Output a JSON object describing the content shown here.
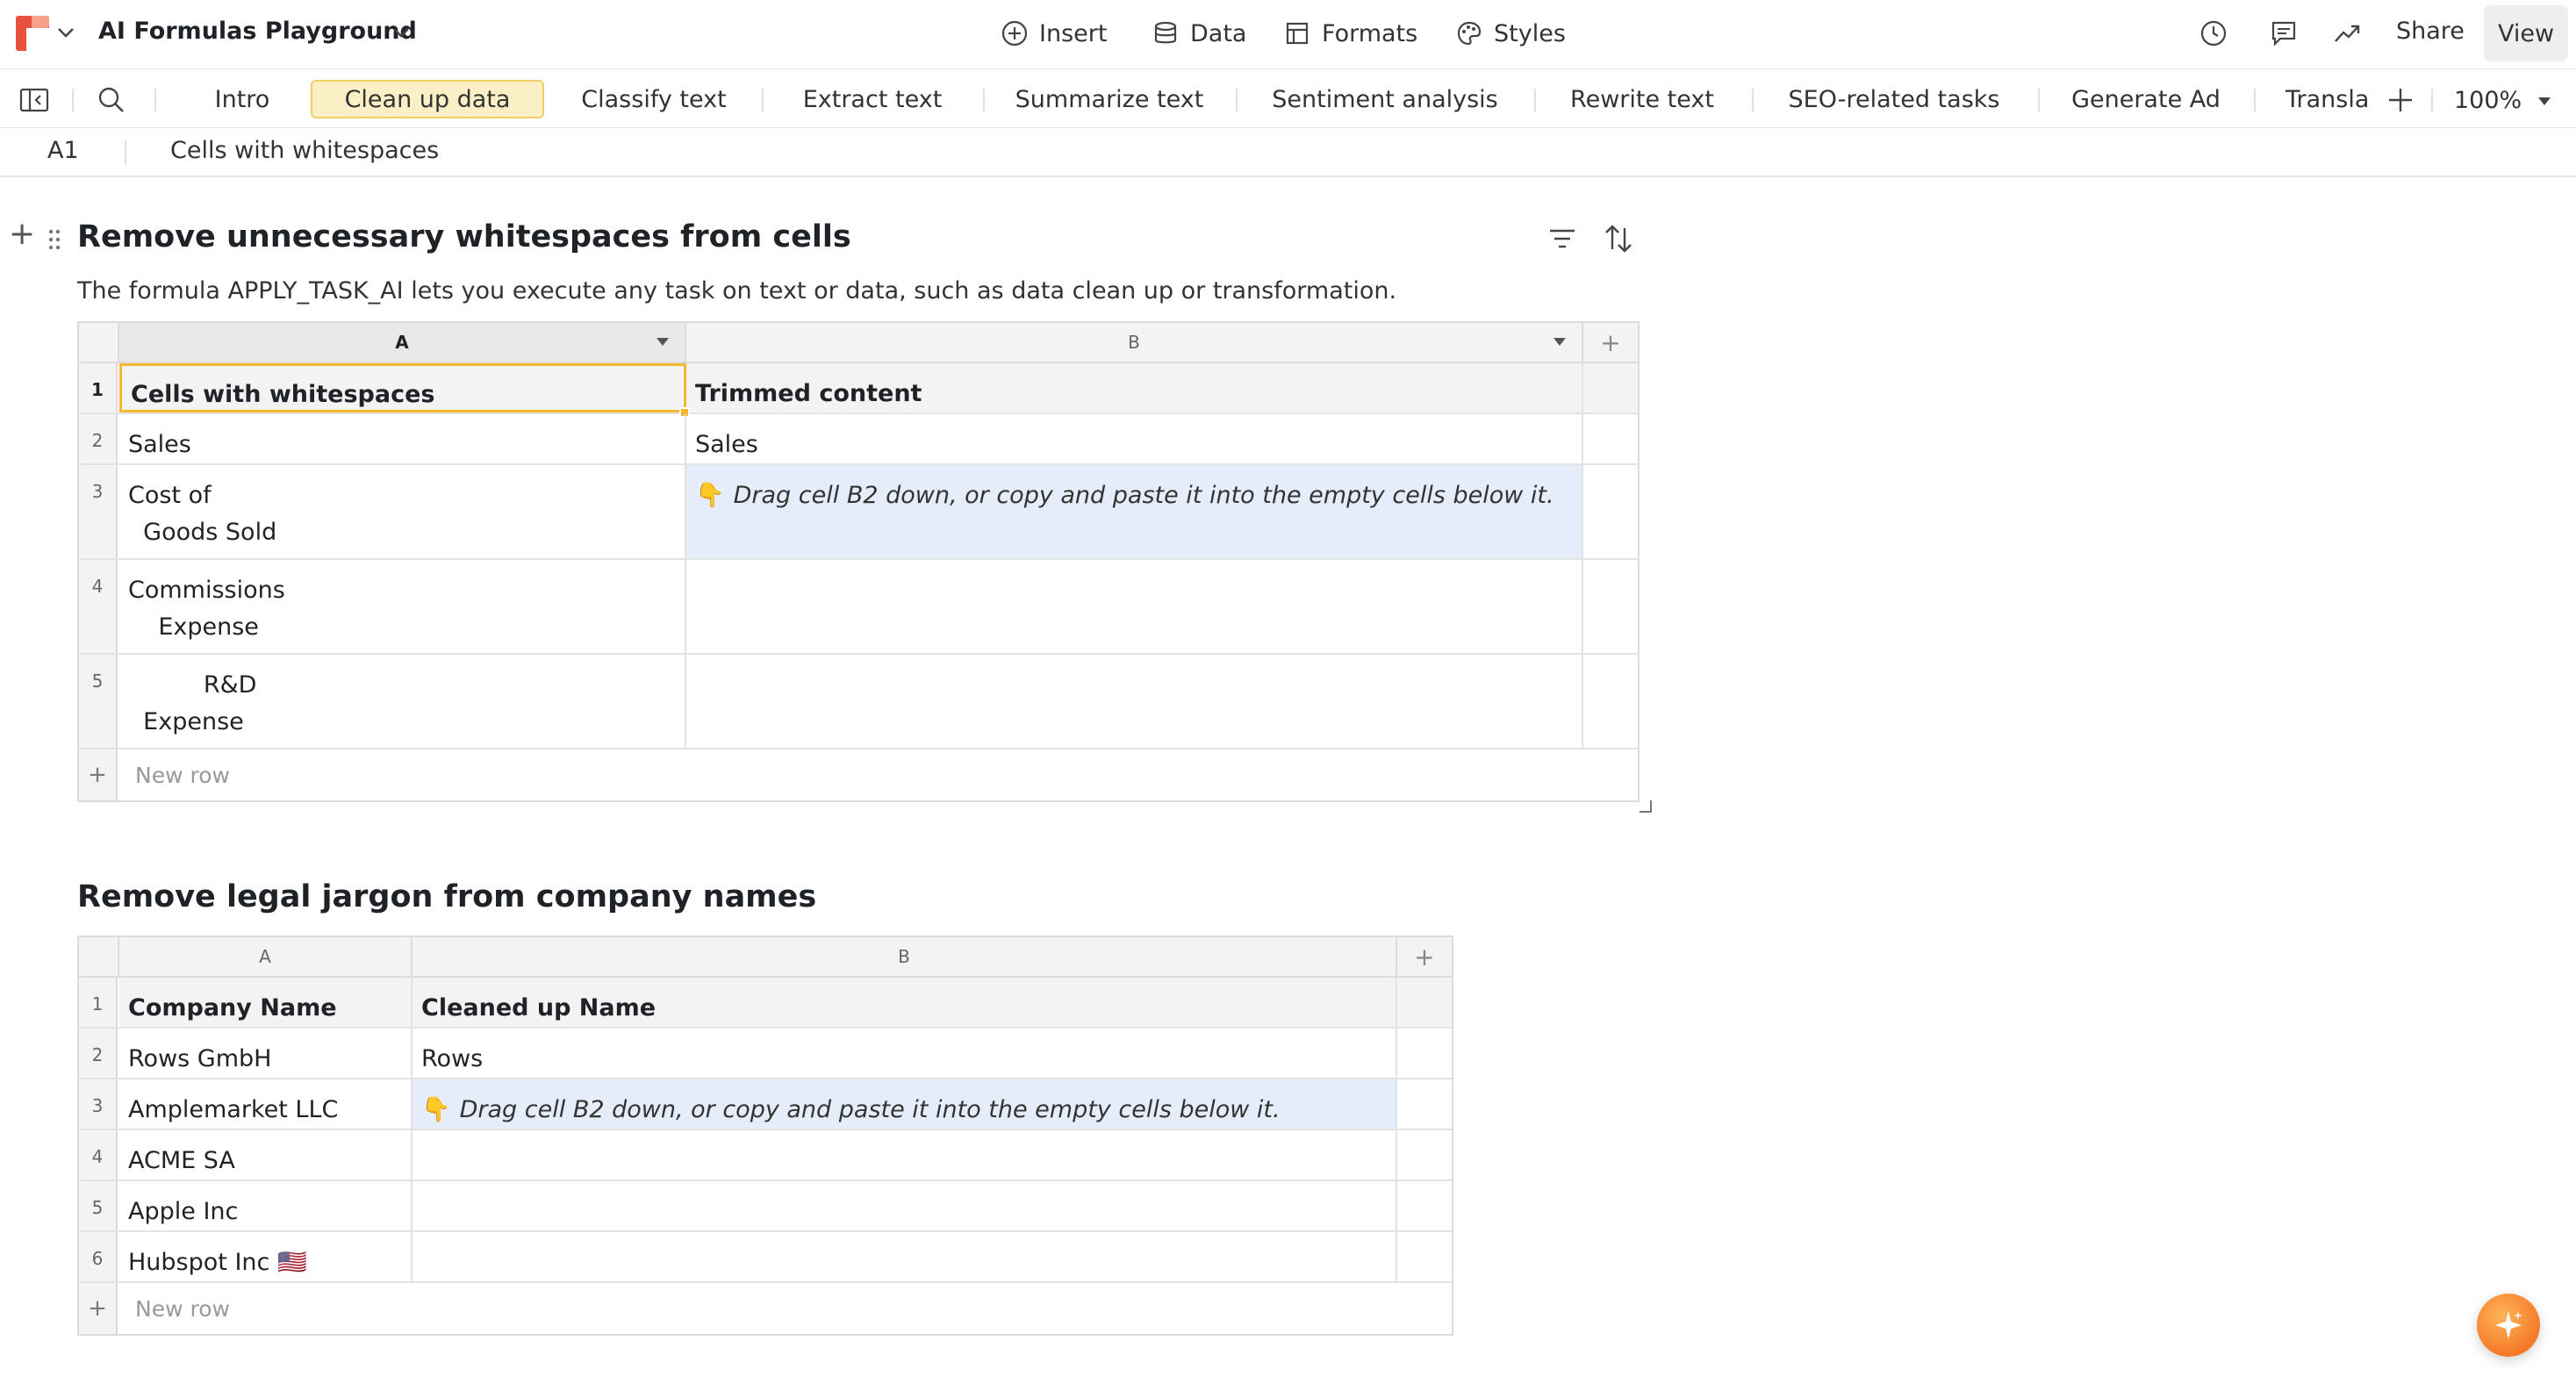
{
  "app": {
    "title": "AI Formulas Playground"
  },
  "toolbar": {
    "insert": "Insert",
    "data": "Data",
    "formats": "Formats",
    "styles": "Styles",
    "share": "Share",
    "view": "View"
  },
  "tabs": [
    {
      "label": "Intro"
    },
    {
      "label": "Clean up data",
      "active": true
    },
    {
      "label": "Classify text"
    },
    {
      "label": "Extract text"
    },
    {
      "label": "Summarize text"
    },
    {
      "label": "Sentiment analysis"
    },
    {
      "label": "Rewrite text"
    },
    {
      "label": "SEO-related tasks"
    },
    {
      "label": "Generate Ad"
    },
    {
      "label": "Transla"
    }
  ],
  "zoom": "100%",
  "refbar": {
    "cell_ref": "A1",
    "cell_value": "Cells with whitespaces"
  },
  "section1": {
    "title": "Remove unnecessary whitespaces from cells",
    "description": "The formula APPLY_TASK_AI lets you execute any task on text or data, such as data clean up or transformation.",
    "columns": [
      "A",
      "B"
    ],
    "rows": [
      {
        "num": "1",
        "a": "Cells with whitespaces",
        "b": "Trimmed content"
      },
      {
        "num": "2",
        "a": "Sales",
        "b": "Sales"
      },
      {
        "num": "3",
        "a": "Cost of\n  Goods Sold",
        "b": "Drag cell B2 down, or copy and paste it into the empty cells below it."
      },
      {
        "num": "4",
        "a": "Commissions\n    Expense",
        "b": ""
      },
      {
        "num": "5",
        "a": "          R&D\n  Expense",
        "b": ""
      }
    ],
    "new_row": "New row"
  },
  "section2": {
    "title": "Remove legal jargon from company names",
    "columns": [
      "A",
      "B"
    ],
    "rows": [
      {
        "num": "1",
        "a": "Company Name",
        "b": "Cleaned up Name"
      },
      {
        "num": "2",
        "a": "Rows GmbH",
        "b": "Rows"
      },
      {
        "num": "3",
        "a": "Amplemarket LLC",
        "b": "Drag cell B2 down, or copy and paste it into the empty cells below it."
      },
      {
        "num": "4",
        "a": "ACME SA",
        "b": ""
      },
      {
        "num": "5",
        "a": "Apple Inc",
        "b": ""
      },
      {
        "num": "6",
        "a": "Hubspot Inc 🇺🇸",
        "b": ""
      }
    ],
    "new_row": "New row"
  },
  "icons": {
    "hint_pointer": "👇"
  },
  "colors": {
    "brand": "#e8513b",
    "active_tab_bg": "#fbefc6",
    "selection": "#f5b731",
    "hint_bg": "#e6edfa",
    "ai_button": "#f57a27"
  }
}
